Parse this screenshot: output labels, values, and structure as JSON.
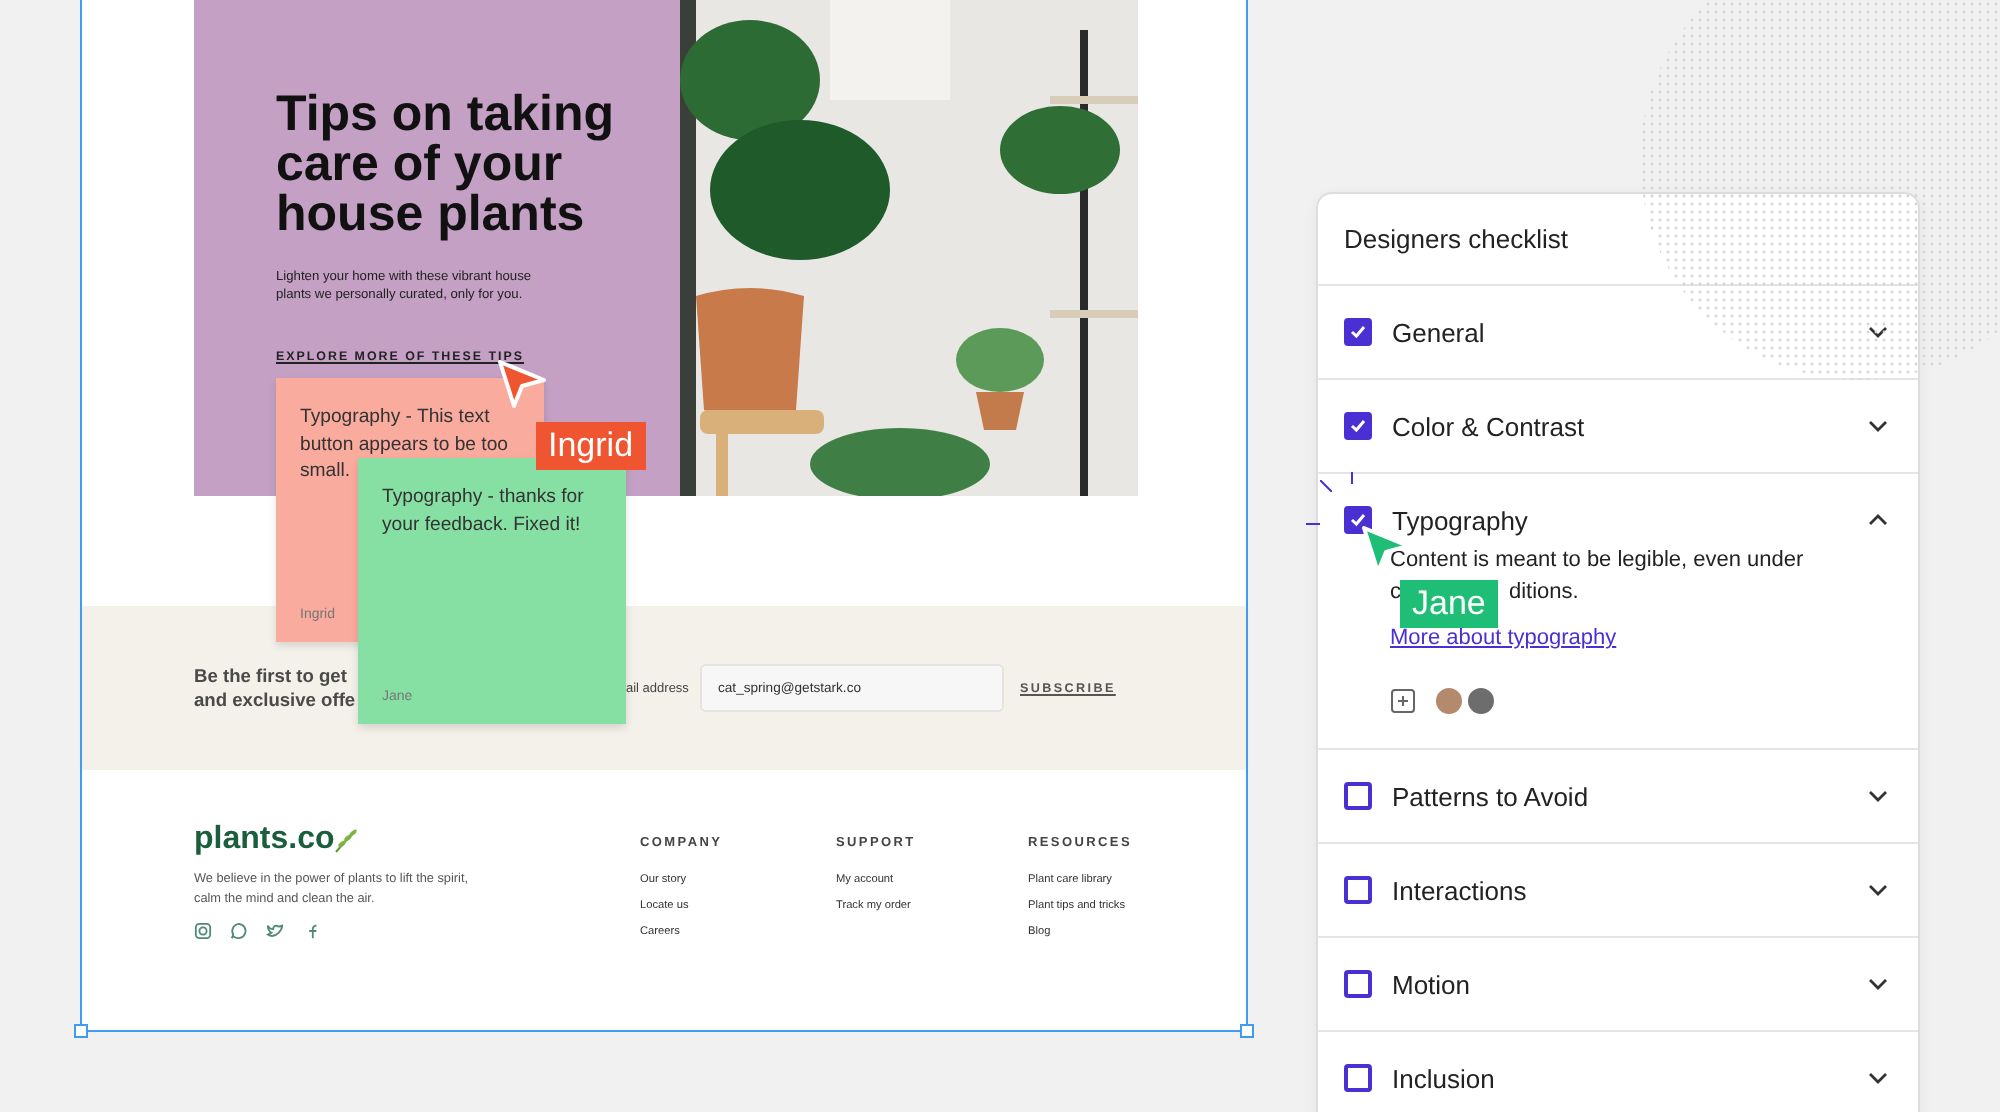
{
  "hero": {
    "title": "Tips on taking care of your house plants",
    "subtitle": "Lighten your home with these vibrant house plants we personally curated, only for you.",
    "link": "EXPLORE MORE OF THESE TIPS"
  },
  "newsletter": {
    "heading_lines": [
      "Be the first to get",
      "and exclusive offe"
    ],
    "email_label": "ail address",
    "email_value": "cat_spring@getstark.co",
    "button": "SUBSCRIBE"
  },
  "footer": {
    "logo": "plants.co",
    "tagline": "We believe in the power of plants to lift the spirit, calm the mind and clean the air.",
    "columns": [
      {
        "heading": "COMPANY",
        "links": [
          "Our story",
          "Locate us",
          "Careers"
        ]
      },
      {
        "heading": "SUPPORT",
        "links": [
          "My account",
          "Track my order"
        ]
      },
      {
        "heading": "RESOURCES",
        "links": [
          "Plant care library",
          "Plant tips and tricks",
          "Blog"
        ]
      }
    ]
  },
  "comments": [
    {
      "text": "Typography - This text button appears to be too small.",
      "author": "Ingrid",
      "color": "#f9ab9d"
    },
    {
      "text": "Typography - thanks for your feedback. Fixed it!",
      "author": "Jane",
      "color": "#86e0a3"
    }
  ],
  "cursors": [
    {
      "name": "Ingrid",
      "color": "#ef5530"
    },
    {
      "name": "Jane",
      "color": "#1fbe77"
    }
  ],
  "checklist": {
    "title": "Designers checklist",
    "items": [
      {
        "label": "General",
        "checked": true,
        "expanded": false
      },
      {
        "label": "Color & Contrast",
        "checked": true,
        "expanded": false
      },
      {
        "label": "Typography",
        "checked": true,
        "expanded": true,
        "description": {
          "line_1": "Content is meant to be legible, even under",
          "line_2_start": "c",
          "line_2_end": "ditions."
        },
        "link": "More about typography"
      },
      {
        "label": "Patterns to Avoid",
        "checked": false,
        "expanded": false
      },
      {
        "label": "Interactions",
        "checked": false,
        "expanded": false
      },
      {
        "label": "Motion",
        "checked": false,
        "expanded": false
      },
      {
        "label": "Inclusion",
        "checked": false,
        "expanded": false
      }
    ]
  }
}
